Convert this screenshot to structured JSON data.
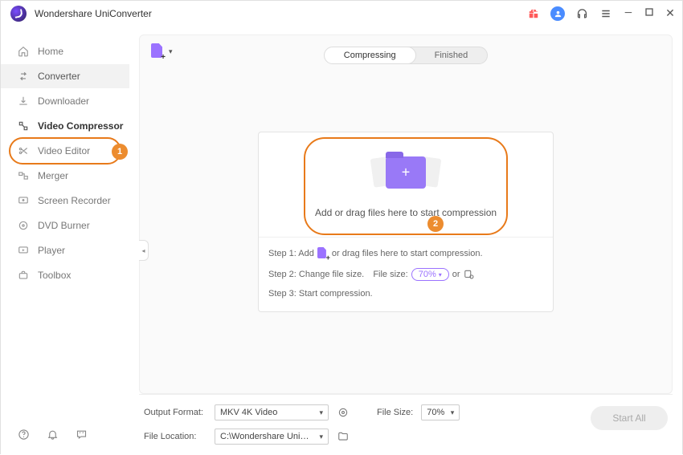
{
  "title": "Wondershare UniConverter",
  "sidebar": {
    "items": [
      {
        "label": "Home"
      },
      {
        "label": "Converter"
      },
      {
        "label": "Downloader"
      },
      {
        "label": "Video Compressor"
      },
      {
        "label": "Video Editor"
      },
      {
        "label": "Merger"
      },
      {
        "label": "Screen Recorder"
      },
      {
        "label": "DVD Burner"
      },
      {
        "label": "Player"
      },
      {
        "label": "Toolbox"
      }
    ]
  },
  "tabs": {
    "compressing": "Compressing",
    "finished": "Finished"
  },
  "dropzone": {
    "text": "Add or drag files here to start compression"
  },
  "steps": {
    "s1a": "Step 1: Add",
    "s1b": "or drag files here to start compression.",
    "s2a": "Step 2: Change file size.",
    "s2b": "File size:",
    "s2pill": "70%",
    "s2or": "or",
    "s3": "Step 3: Start compression."
  },
  "footer": {
    "outputFormatLabel": "Output Format:",
    "outputFormatValue": "MKV 4K Video",
    "fileSizeLabel": "File Size:",
    "fileSizeValue": "70%",
    "fileLocationLabel": "File Location:",
    "fileLocationValue": "C:\\Wondershare UniConverter",
    "startAll": "Start All"
  },
  "annotations": {
    "n1": "1",
    "n2": "2"
  }
}
